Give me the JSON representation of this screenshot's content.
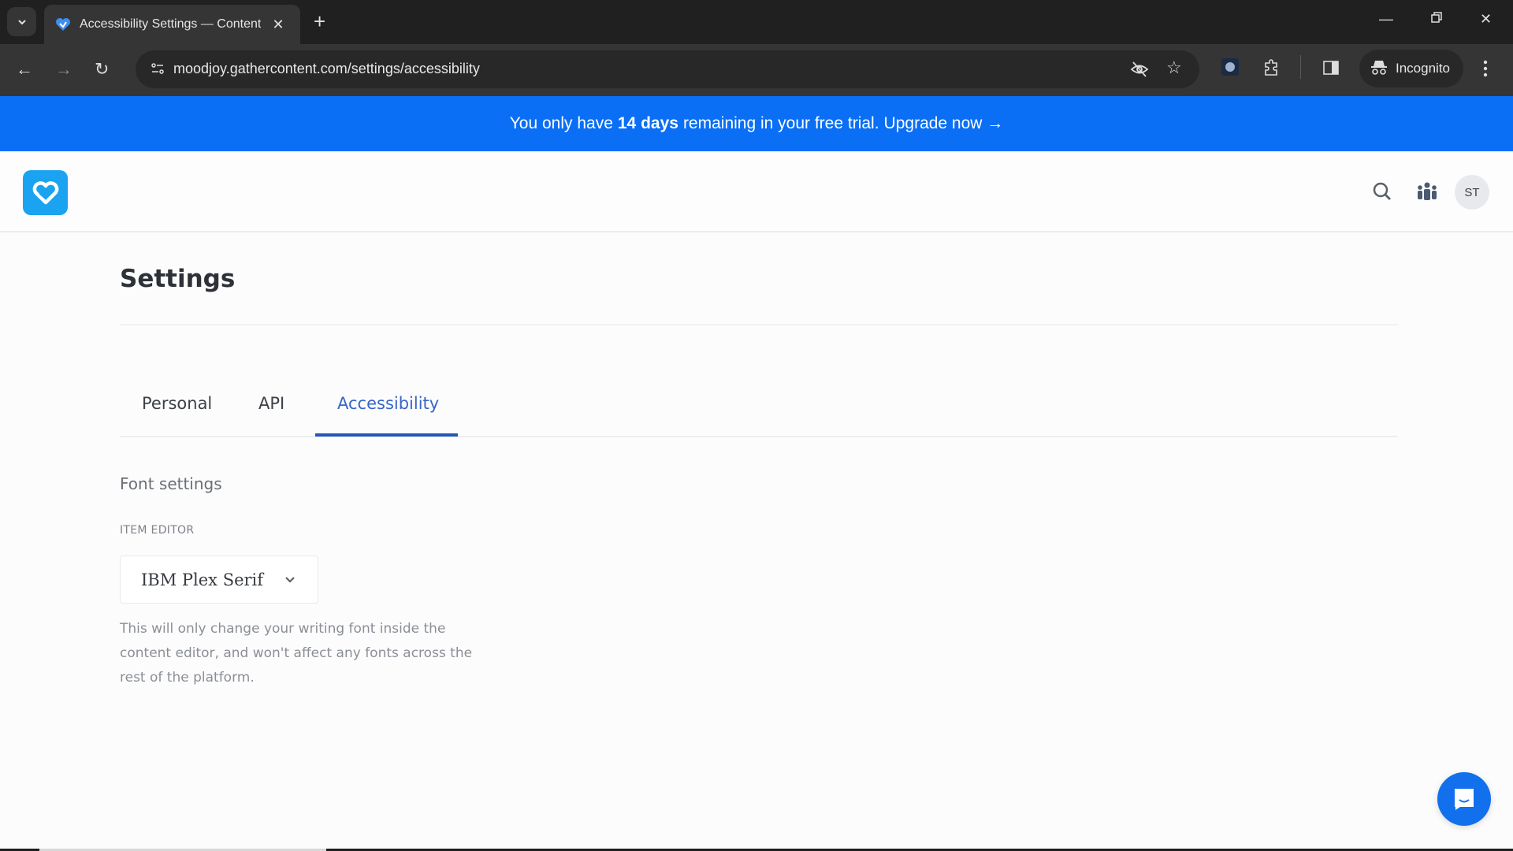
{
  "browser": {
    "tab": {
      "title": "Accessibility Settings — Content",
      "favicon": "gathercontent-heart-icon"
    },
    "url": "moodjoy.gathercontent.com/settings/accessibility",
    "incognito_label": "Incognito",
    "icons": [
      "tab-search-icon",
      "new-tab-icon",
      "minimize-icon",
      "restore-icon",
      "close-window-icon",
      "back-icon",
      "forward-icon",
      "reload-icon",
      "site-controls-icon",
      "eye-off-icon",
      "star-icon",
      "extension-avatar-icon",
      "puzzle-icon",
      "side-panel-icon",
      "incognito-icon",
      "kebab-menu-icon"
    ]
  },
  "banner": {
    "prefix": "You only have",
    "highlight": "14 days",
    "suffix": "remaining in your free trial.",
    "link": "Upgrade now →",
    "color": "#0a6ff5"
  },
  "header": {
    "logo": "gathercontent-logo",
    "avatar_initials": "ST",
    "icons": [
      "search-icon",
      "team-icon"
    ]
  },
  "page": {
    "title": "Settings",
    "tabs": [
      {
        "label": "Personal",
        "active": false
      },
      {
        "label": "API",
        "active": false
      },
      {
        "label": "Accessibility",
        "active": true
      }
    ],
    "section_title": "Font settings",
    "field_label": "ITEM EDITOR",
    "font_select_value": "IBM Plex Serif",
    "help_text": "This will only change your writing font inside the content editor, and won't affect any fonts across the rest of the platform."
  },
  "colors": {
    "accent": "#2457b7",
    "chat": "#1270ec",
    "logo": "#1aa3f0"
  }
}
